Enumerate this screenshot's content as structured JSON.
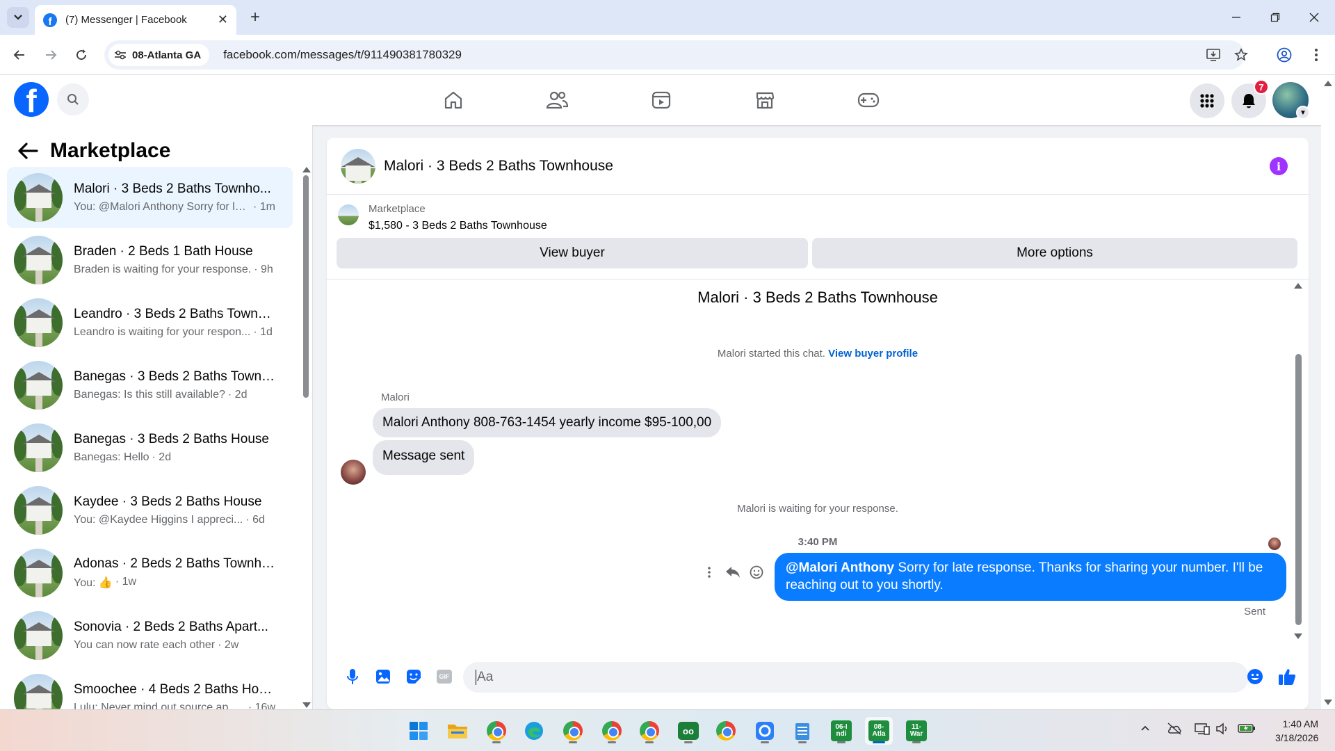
{
  "browser": {
    "tab_title": "(7) Messenger | Facebook",
    "site_chip": "08-Atlanta GA",
    "url": "facebook.com/messages/t/911490381780329",
    "new_tab": "+",
    "close_tab": "✕"
  },
  "header": {
    "notification_count": "7"
  },
  "sidebar": {
    "title": "Marketplace",
    "conversations": [
      {
        "name": "Malori · 3 Beds 2 Baths Townho...",
        "snippet": "You: @Malori Anthony Sorry for lat...",
        "time": "· 1m",
        "active": true
      },
      {
        "name": "Braden · 2 Beds 1 Bath House",
        "snippet": "Braden is waiting for your response.",
        "time": "· 9h"
      },
      {
        "name": "Leandro · 3 Beds 2 Baths Townh...",
        "snippet": "Leandro is waiting for your respon...",
        "time": "· 1d"
      },
      {
        "name": "Banegas · 3 Beds 2 Baths Townh...",
        "snippet": "Banegas: Is this still available?",
        "time": "· 2d"
      },
      {
        "name": "Banegas · 3 Beds 2 Baths House",
        "snippet": "Banegas: Hello",
        "time": "· 2d"
      },
      {
        "name": "Kaydee · 3 Beds 2 Baths House",
        "snippet": "You: @Kaydee Higgins I appreci...",
        "time": "· 6d"
      },
      {
        "name": "Adonas · 2 Beds 2 Baths Townho...",
        "snippet": "You: 👍",
        "time": "· 1w"
      },
      {
        "name": "Sonovia · 2 Beds 2 Baths Apart...",
        "snippet": "You can now rate each other",
        "time": "· 2w"
      },
      {
        "name": "Smoochee · 4 Beds 2 Baths House",
        "snippet": "Lulu: Never mind out source apot...",
        "time": "· 16w"
      }
    ]
  },
  "chat": {
    "title": "Malori · 3 Beds 2 Baths Townhouse",
    "listing_label": "Marketplace",
    "listing_price": "$1,580 - 3 Beds 2 Baths Townhouse",
    "view_buyer": "View buyer",
    "more_options": "More options",
    "thread_title": "Malori · 3 Beds 2 Baths Townhouse",
    "started_text": "Malori started this chat.",
    "view_profile": "View buyer profile",
    "sender_name": "Malori",
    "messages_in": [
      "Malori Anthony 808-763-1454 yearly income $95-100,00",
      "Message sent"
    ],
    "waiting_text": "Malori is waiting for your response.",
    "time_divider": "3:40 PM",
    "out_mention": "@Malori Anthony",
    "out_text": " Sorry for late response. Thanks for sharing your number. I'll be reaching out to you shortly.",
    "sent_label": "Sent",
    "input_placeholder": "Aa",
    "gif_label": "GIF"
  },
  "taskbar": {
    "tiles": [
      {
        "label": "06-I\nndi",
        "color": "#1e8e3e"
      },
      {
        "label": "08-\nAtla",
        "color": "#1e8e3e"
      },
      {
        "label": "11-\nWar",
        "color": "#1e8e3e"
      }
    ],
    "time": "1:40 AM",
    "date": "3/18/2026"
  },
  "colors": {
    "fb_blue": "#0866ff",
    "bubble_out": "#0a7cff",
    "badge_red": "#e41e3f",
    "info_purple": "#a033ff"
  }
}
